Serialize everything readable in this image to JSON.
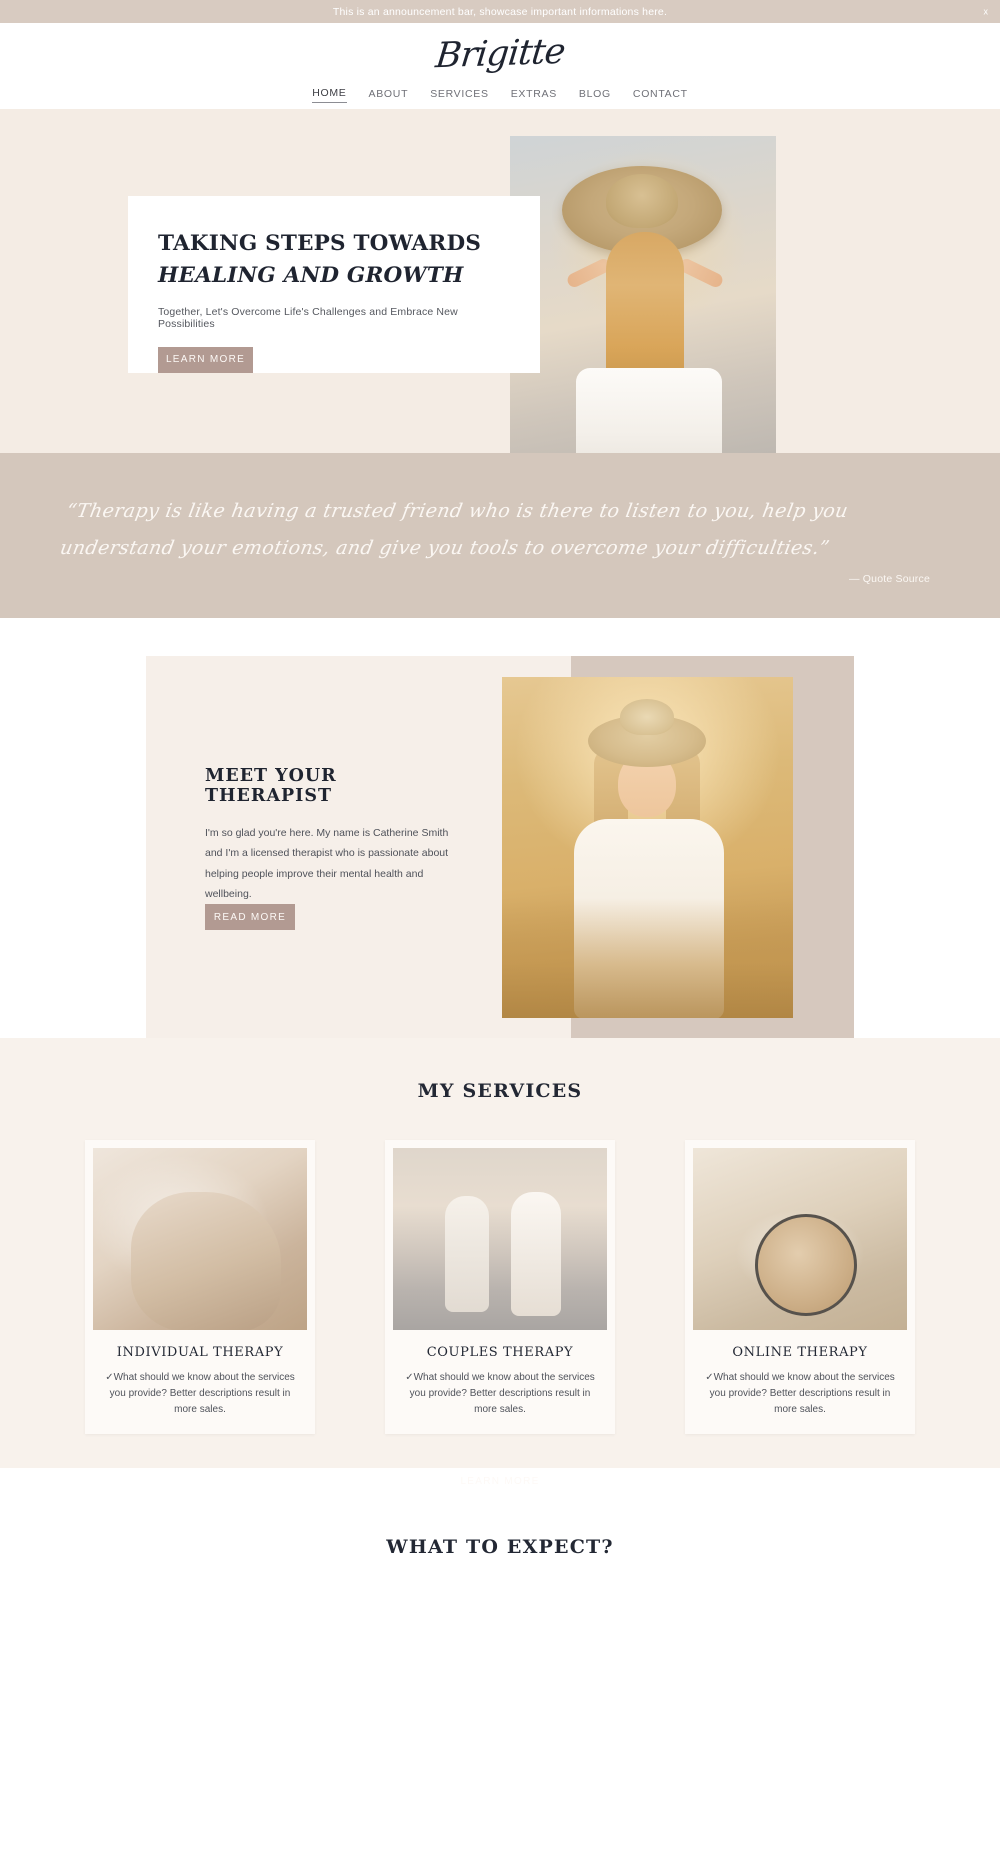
{
  "announcement": {
    "text": "This is an announcement bar, showcase important informations here.",
    "close_label": "x"
  },
  "header": {
    "logo": "Brigitte",
    "nav": [
      {
        "label": "HOME",
        "active": true
      },
      {
        "label": "ABOUT",
        "active": false
      },
      {
        "label": "SERVICES",
        "active": false
      },
      {
        "label": "EXTRAS",
        "active": false
      },
      {
        "label": "BLOG",
        "active": false
      },
      {
        "label": "CONTACT",
        "active": false
      }
    ]
  },
  "hero": {
    "title_part1": "TAKING STEPS TOWARDS ",
    "title_part2": "HEALING AND GROWTH",
    "subtitle": "Together, Let's Overcome Life's Challenges and Embrace New Possibilities",
    "button": "LEARN MORE"
  },
  "quote": {
    "text": "“Therapy is like having a trusted friend who is there to listen to you, help you understand your emotions, and give you tools to overcome your difficulties.”",
    "source": "— Quote Source"
  },
  "about": {
    "title": "MEET YOUR THERAPIST",
    "body": "I'm so glad you're here.\nMy name is Catherine Smith and I'm a licensed therapist who is passionate about helping people improve their mental health and wellbeing.",
    "button": "READ MORE"
  },
  "services": {
    "title": "MY SERVICES",
    "cards": [
      {
        "title": "INDIVIDUAL THERAPY",
        "desc": "✓What should we know about the services you provide? Better descriptions result in more sales."
      },
      {
        "title": "COUPLES THERAPY",
        "desc": "✓What should we know about the services you provide? Better descriptions result in more sales."
      },
      {
        "title": "ONLINE THERAPY",
        "desc": "✓What should we know about the services you provide? Better descriptions result in more sales."
      }
    ],
    "button": "LEARN MORE"
  },
  "expect": {
    "title": "WHAT TO EXPECT?"
  },
  "colors": {
    "announcement_bg": "#d8cbc1",
    "quote_bg": "#d4c7bc",
    "hero_bg": "#f4ece4",
    "services_bg": "#f8f2ec",
    "accent_mauve": "#b29a92",
    "accent_dark": "#2e3440"
  }
}
